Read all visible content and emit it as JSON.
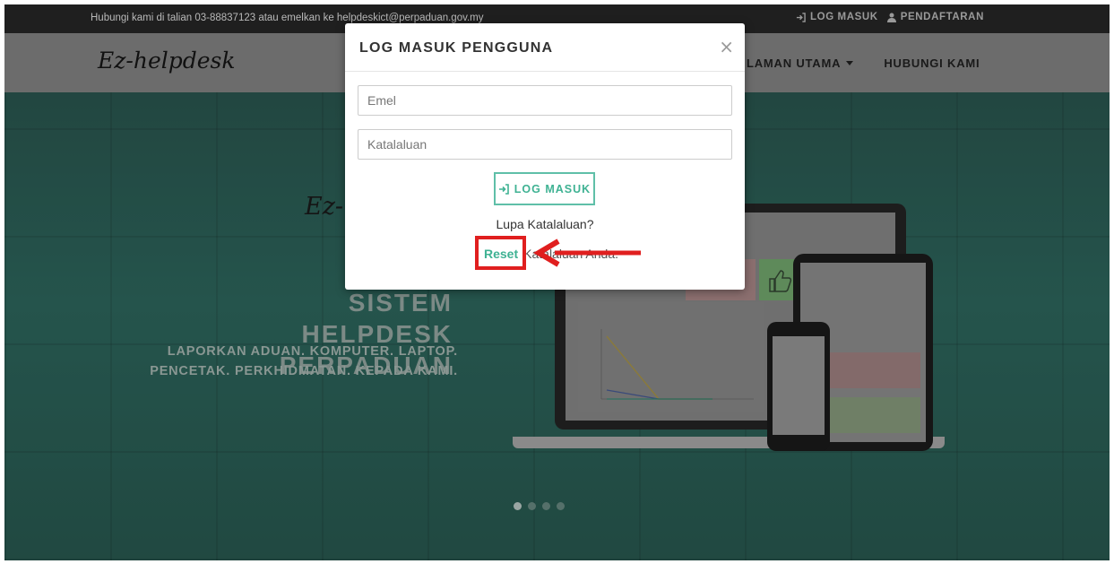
{
  "topbar": {
    "contact": "Hubungi kami di talian 03-88837123 atau emelkan ke helpdeskict@perpaduan.gov.my",
    "login": "LOG MASUK",
    "register": "PENDAFTARAN"
  },
  "navbar": {
    "brand": "Ez-helpdesk",
    "home": "LAMAN UTAMA",
    "contact": "HUBUNGI KAMI"
  },
  "hero": {
    "brand_script": "Ez-",
    "title_line1": "SISTEM",
    "title_line2": "HELPDESK",
    "title_line3": "PERPADUAN",
    "subtitle_line1": "LAPORKAN ADUAN. KOMPUTER. LAPTOP.",
    "subtitle_line2": "PENCETAK. PERKHIDMATAN. KEPADA KAMI.",
    "slides": 4,
    "active_slide": 0
  },
  "modal": {
    "title": "LOG MASUK PENGGUNA",
    "close": "×",
    "email_placeholder": "Emel",
    "password_placeholder": "Katalaluan",
    "login_button": "LOG MASUK",
    "forgot": "Lupa Katalaluan?",
    "reset_link": "Reset",
    "reset_text": "Katalaluan Anda."
  },
  "colors": {
    "accent": "#3fb293",
    "highlight": "#e01f1f",
    "topbar": "#1f1f1f",
    "navbar": "#6c6c6c"
  }
}
